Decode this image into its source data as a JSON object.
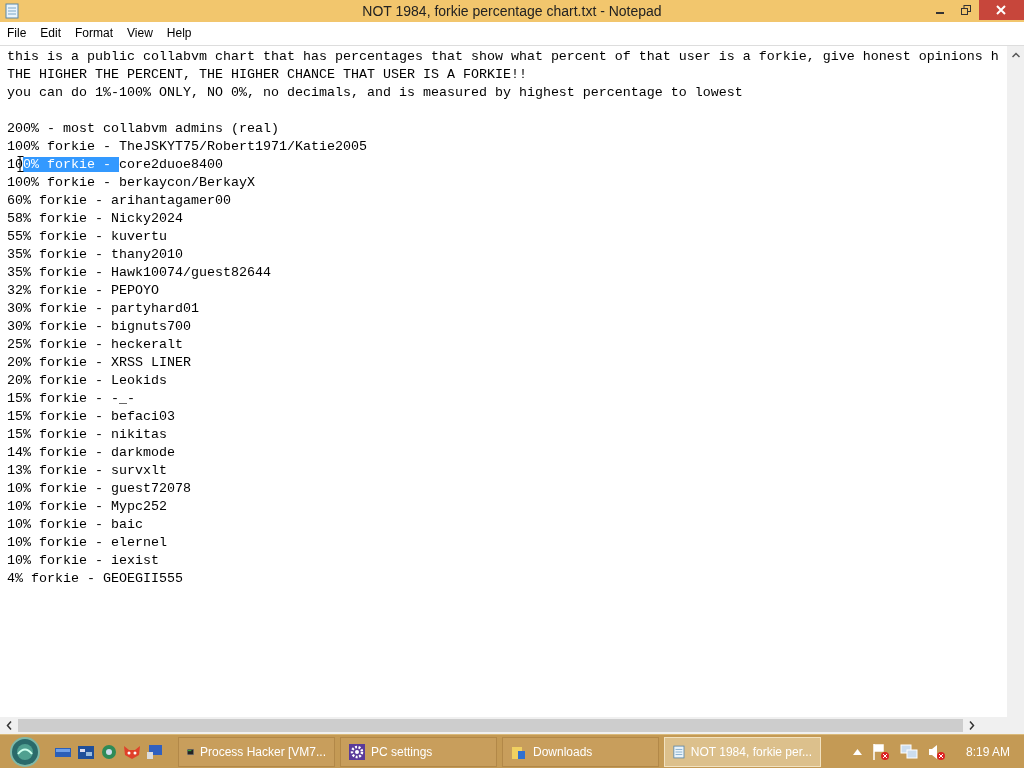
{
  "window": {
    "title": "NOT 1984, forkie percentage chart.txt - Notepad"
  },
  "menu": [
    "File",
    "Edit",
    "Format",
    "View",
    "Help"
  ],
  "document": {
    "lines": [
      {
        "kind": "text",
        "text": "this is a public collabvm chart that has percentages that show what percent of that user is a forkie, give honest opinions h"
      },
      {
        "kind": "text",
        "text": "THE HIGHER THE PERCENT, THE HIGHER CHANCE THAT USER IS A FORKIE!!"
      },
      {
        "kind": "text",
        "text": "you can do 1%-100% ONLY, NO 0%, no decimals, and is measured by highest percentage to lowest"
      },
      {
        "kind": "blank"
      },
      {
        "kind": "text",
        "text": "200% - most collabvm admins (real)"
      },
      {
        "kind": "text",
        "text": "100% forkie - TheJSKYT75/Robert1971/Katie2005"
      },
      {
        "kind": "segments",
        "segments": [
          {
            "text": "10",
            "selected": false
          },
          {
            "text": "0% forkie - ",
            "selected": true
          },
          {
            "text": "core2duoe8400",
            "selected": false
          }
        ]
      },
      {
        "kind": "text",
        "text": "100% forkie - berkaycon/BerkayX"
      },
      {
        "kind": "text",
        "text": "60% forkie - arihantagamer00"
      },
      {
        "kind": "text",
        "text": "58% forkie - Nicky2024"
      },
      {
        "kind": "text",
        "text": "55% forkie - kuvertu"
      },
      {
        "kind": "text",
        "text": "35% forkie - thany2010"
      },
      {
        "kind": "text",
        "text": "35% forkie - Hawk10074/guest82644"
      },
      {
        "kind": "text",
        "text": "32% forkie - PEPOYO"
      },
      {
        "kind": "text",
        "text": "30% forkie - partyhard01"
      },
      {
        "kind": "text",
        "text": "30% forkie - bignuts700"
      },
      {
        "kind": "text",
        "text": "25% forkie - heckeralt"
      },
      {
        "kind": "text",
        "text": "20% forkie - XRSS LINER"
      },
      {
        "kind": "text",
        "text": "20% forkie - Leokids"
      },
      {
        "kind": "text",
        "text": "15% forkie - -_-"
      },
      {
        "kind": "text",
        "text": "15% forkie - befaci03"
      },
      {
        "kind": "text",
        "text": "15% forkie - nikitas"
      },
      {
        "kind": "text",
        "text": "14% forkie - darkmode"
      },
      {
        "kind": "text",
        "text": "13% forkie - survxlt"
      },
      {
        "kind": "text",
        "text": "10% forkie - guest72078"
      },
      {
        "kind": "text",
        "text": "10% forkie - Mypc252"
      },
      {
        "kind": "text",
        "text": "10% forkie - baic"
      },
      {
        "kind": "text",
        "text": "10% forkie - elernel"
      },
      {
        "kind": "text",
        "text": "10% forkie - iexist"
      },
      {
        "kind": "text",
        "text": "4% forkie - GEOEGII555"
      }
    ]
  },
  "taskbar": {
    "tasks": [
      {
        "label": "Process Hacker [VM7...",
        "kind": "terminal",
        "selected": false
      },
      {
        "label": "PC settings",
        "kind": "gear",
        "selected": false
      },
      {
        "label": "Downloads",
        "kind": "folder",
        "selected": false
      },
      {
        "label": "NOT 1984, forkie per...",
        "kind": "notepad",
        "selected": true
      }
    ],
    "clock": "8:19 AM"
  }
}
